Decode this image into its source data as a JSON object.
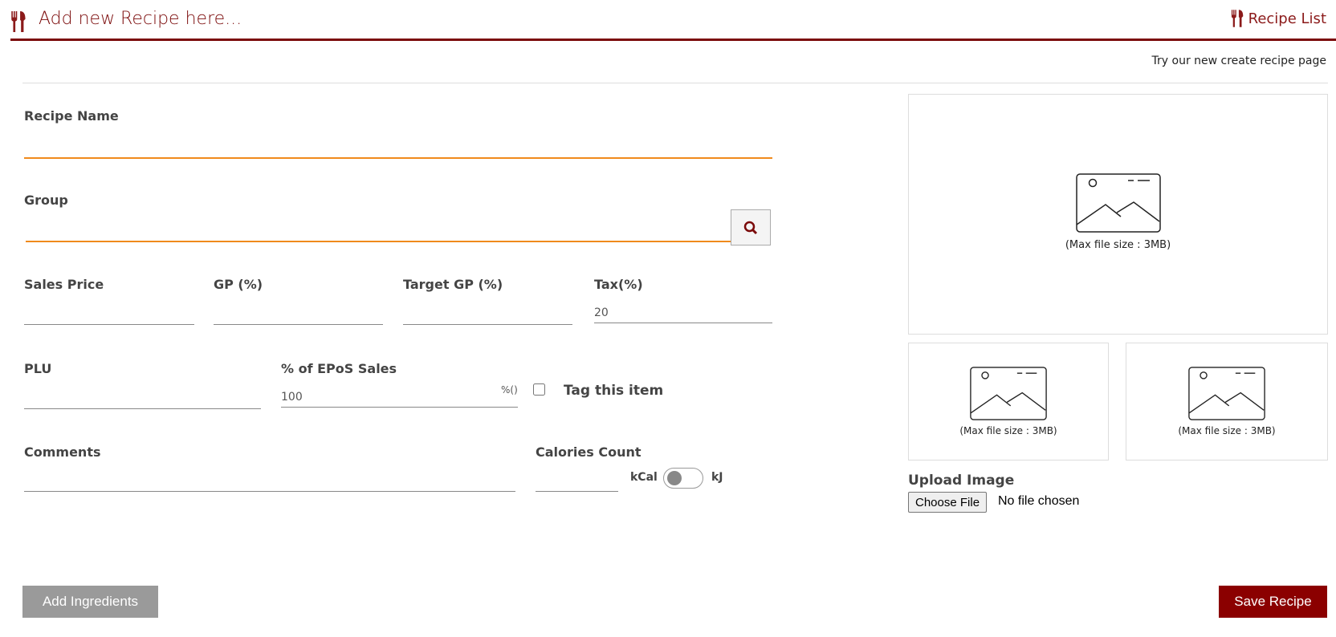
{
  "header": {
    "title": "Add new Recipe here...",
    "recipe_list_link": "Recipe List",
    "try_new_link": "Try our new create recipe page"
  },
  "form": {
    "recipe_name": {
      "label": "Recipe Name",
      "value": ""
    },
    "group": {
      "label": "Group",
      "value": ""
    },
    "sales_price": {
      "label": "Sales Price",
      "value": ""
    },
    "gp": {
      "label": "GP (%)",
      "value": ""
    },
    "target_gp": {
      "label": "Target GP (%)",
      "value": ""
    },
    "tax": {
      "label": "Tax(%)",
      "value": "20"
    },
    "plu": {
      "label": "PLU",
      "value": ""
    },
    "epos": {
      "label": "% of EPoS Sales",
      "value": "100",
      "suffix": "%()"
    },
    "tag": {
      "label": "Tag this item",
      "checked": false
    },
    "comments": {
      "label": "Comments",
      "value": ""
    },
    "calories": {
      "label": "Calories Count",
      "value": "",
      "unit_left": "kCal",
      "unit_right": "kJ"
    }
  },
  "images": {
    "max_size_text": "(Max file size : 3MB)",
    "upload_label": "Upload Image",
    "choose_file": "Choose File",
    "no_file": "No file chosen"
  },
  "buttons": {
    "add_ingredients": "Add Ingredients",
    "save_recipe": "Save Recipe"
  },
  "colors": {
    "brand": "#7b0a0a",
    "accent": "#f08a1c"
  }
}
